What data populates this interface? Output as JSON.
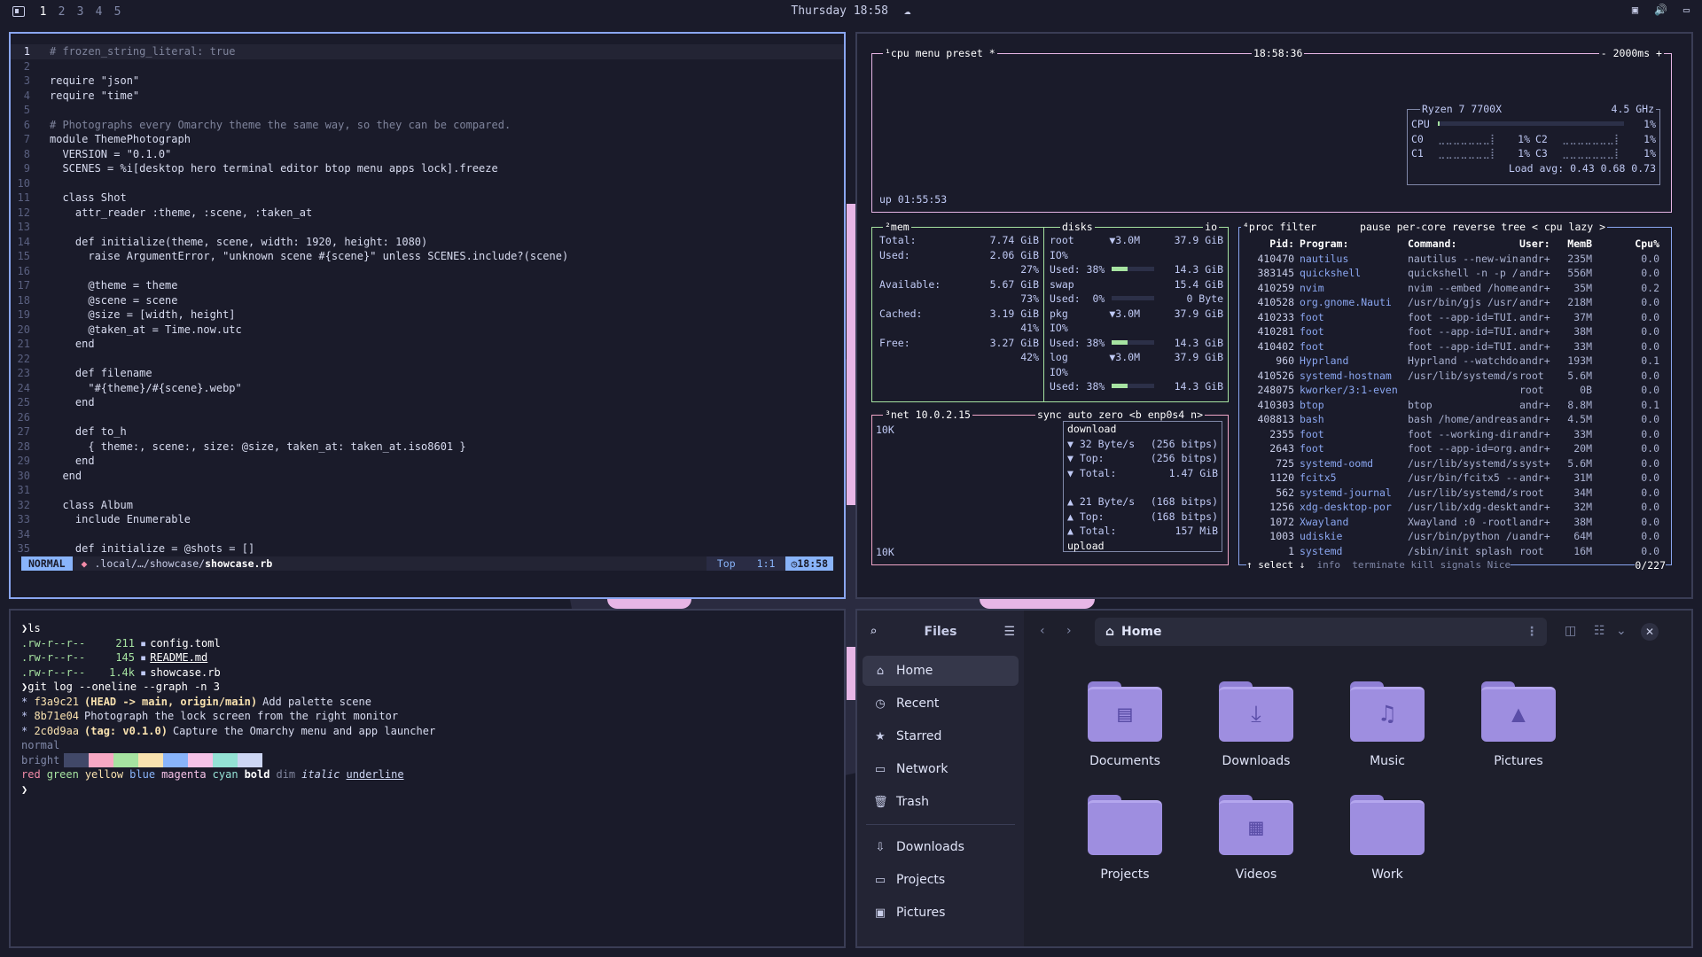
{
  "topbar": {
    "workspaces": [
      "1",
      "2",
      "3",
      "4",
      "5"
    ],
    "active_workspace": "1",
    "clock": "Thursday 18:58",
    "icons": [
      "screenshot-icon",
      "volume-icon",
      "monitor-icon"
    ]
  },
  "editor": {
    "lines": [
      {
        "n": "1",
        "t": "# frozen_string_literal: true"
      },
      {
        "n": "2",
        "t": ""
      },
      {
        "n": "3",
        "t": "require \"json\""
      },
      {
        "n": "4",
        "t": "require \"time\""
      },
      {
        "n": "5",
        "t": ""
      },
      {
        "n": "6",
        "t": "# Photographs every Omarchy theme the same way, so they can be compared."
      },
      {
        "n": "7",
        "t": "module ThemePhotograph"
      },
      {
        "n": "8",
        "t": "  VERSION = \"0.1.0\""
      },
      {
        "n": "9",
        "t": "  SCENES = %i[desktop hero terminal editor btop menu apps lock].freeze"
      },
      {
        "n": "10",
        "t": ""
      },
      {
        "n": "11",
        "t": "  class Shot"
      },
      {
        "n": "12",
        "t": "    attr_reader :theme, :scene, :taken_at"
      },
      {
        "n": "13",
        "t": ""
      },
      {
        "n": "14",
        "t": "    def initialize(theme, scene, width: 1920, height: 1080)"
      },
      {
        "n": "15",
        "t": "      raise ArgumentError, \"unknown scene #{scene}\" unless SCENES.include?(scene)"
      },
      {
        "n": "16",
        "t": ""
      },
      {
        "n": "17",
        "t": "      @theme = theme"
      },
      {
        "n": "18",
        "t": "      @scene = scene"
      },
      {
        "n": "19",
        "t": "      @size = [width, height]"
      },
      {
        "n": "20",
        "t": "      @taken_at = Time.now.utc"
      },
      {
        "n": "21",
        "t": "    end"
      },
      {
        "n": "22",
        "t": ""
      },
      {
        "n": "23",
        "t": "    def filename"
      },
      {
        "n": "24",
        "t": "      \"#{theme}/#{scene}.webp\""
      },
      {
        "n": "25",
        "t": "    end"
      },
      {
        "n": "26",
        "t": ""
      },
      {
        "n": "27",
        "t": "    def to_h"
      },
      {
        "n": "28",
        "t": "      { theme:, scene:, size: @size, taken_at: taken_at.iso8601 }"
      },
      {
        "n": "29",
        "t": "    end"
      },
      {
        "n": "30",
        "t": "  end"
      },
      {
        "n": "31",
        "t": ""
      },
      {
        "n": "32",
        "t": "  class Album"
      },
      {
        "n": "33",
        "t": "    include Enumerable"
      },
      {
        "n": "34",
        "t": ""
      },
      {
        "n": "35",
        "t": "    def initialize = @shots = []"
      }
    ],
    "status": {
      "mode": "NORMAL",
      "path_prefix": ".local/…/showcase/",
      "file": "showcase.rb",
      "scroll": "Top",
      "position": "1:1",
      "time": "18:58"
    }
  },
  "btop": {
    "cpu": {
      "title": "¹cpu",
      "menu": "menu",
      "preset": "preset *",
      "clock": "18:58:36",
      "interval": "- 2000ms +",
      "model": "Ryzen 7 7700X",
      "freq": "4.5 GHz",
      "rows": [
        {
          "label": "CPU",
          "val": "1%"
        },
        {
          "label": "C0",
          "val": "1%",
          "label2": "C2",
          "val2": "1%"
        },
        {
          "label": "C1",
          "val": "1%",
          "label2": "C3",
          "val2": "1%"
        }
      ],
      "load": "Load avg: 0.43 0.68 0.73",
      "uptime": "up 01:55:53"
    },
    "mem": {
      "title": "²mem",
      "disks_title": "disks",
      "io_title": "io",
      "rows": [
        {
          "k": "Total:",
          "v": "7.74 GiB"
        },
        {
          "k": "Used:",
          "v": "2.06 GiB"
        },
        {
          "k": "",
          "v": "27%"
        },
        {
          "k": "Available:",
          "v": "5.67 GiB"
        },
        {
          "k": "",
          "v": "73%"
        },
        {
          "k": "Cached:",
          "v": "3.19 GiB"
        },
        {
          "k": "",
          "v": "41%"
        },
        {
          "k": "Free:",
          "v": "3.27 GiB"
        },
        {
          "k": "",
          "v": "42%"
        }
      ],
      "disks": [
        {
          "a": "root",
          "b": "▼3.0M",
          "c": "37.9 GiB"
        },
        {
          "a": "IO%",
          "b": "",
          "c": ""
        },
        {
          "a": "Used: 38%",
          "b": "",
          "c": "14.3 GiB",
          "fill": 0.38
        },
        {
          "a": "swap",
          "b": "",
          "c": "15.4 GiB"
        },
        {
          "a": "Used:  0%",
          "b": "",
          "c": "0 Byte",
          "fill": 0.0
        },
        {
          "a": "pkg",
          "b": "▼3.0M",
          "c": "37.9 GiB"
        },
        {
          "a": "IO%",
          "b": "",
          "c": ""
        },
        {
          "a": "Used: 38%",
          "b": "",
          "c": "14.3 GiB",
          "fill": 0.38
        },
        {
          "a": "log",
          "b": "▼3.0M",
          "c": "37.9 GiB"
        },
        {
          "a": "IO%",
          "b": "",
          "c": ""
        },
        {
          "a": "Used: 38%",
          "b": "",
          "c": "14.3 GiB",
          "fill": 0.38
        }
      ]
    },
    "net": {
      "title": "³net",
      "ip": "10.0.2.15",
      "controls": [
        "sync",
        "auto",
        "zero",
        "<b enp0s4 n>"
      ],
      "scale_top": "10K",
      "scale_bottom": "10K",
      "download": [
        {
          "k": "download",
          "v": ""
        },
        {
          "k": "▼ 32 Byte/s",
          "v": "(256 bitps)"
        },
        {
          "k": "▼ Top:",
          "v": "(256 bitps)"
        },
        {
          "k": "▼ Total:",
          "v": "1.47 GiB"
        }
      ],
      "upload": [
        {
          "k": "▲ 21 Byte/s",
          "v": "(168 bitps)"
        },
        {
          "k": "▲ Top:",
          "v": "(168 bitps)"
        },
        {
          "k": "▲ Total:",
          "v": "157 MiB"
        },
        {
          "k": "upload",
          "v": ""
        }
      ]
    },
    "proc": {
      "title": "⁴proc",
      "controls": [
        "filter",
        "pause",
        "per-core",
        "reverse",
        "tree",
        "< cpu lazy >"
      ],
      "headers": [
        "Pid:",
        "Program:",
        "Command:",
        "User:",
        "MemB",
        "",
        "Cpu%"
      ],
      "rows": [
        [
          "410470",
          "nautilus",
          "nautilus --new-win",
          "andr+",
          "235M",
          "",
          "0.0"
        ],
        [
          "383145",
          "quickshell",
          "quickshell -n -p /",
          "andr+",
          "556M",
          "",
          "0.0"
        ],
        [
          "410259",
          "nvim",
          "nvim --embed /home",
          "andr+",
          "35M",
          "",
          "0.2"
        ],
        [
          "410528",
          "org.gnome.Nauti",
          "/usr/bin/gjs /usr/",
          "andr+",
          "218M",
          "",
          "0.0"
        ],
        [
          "410233",
          "foot",
          "foot --app-id=TUI.",
          "andr+",
          "37M",
          "",
          "0.0"
        ],
        [
          "410281",
          "foot",
          "foot --app-id=TUI.",
          "andr+",
          "38M",
          "",
          "0.0"
        ],
        [
          "410402",
          "foot",
          "foot --app-id=TUI.",
          "andr+",
          "33M",
          "",
          "0.0"
        ],
        [
          "960",
          "Hyprland",
          "Hyprland --watchdo",
          "andr+",
          "193M",
          "",
          "0.1"
        ],
        [
          "410526",
          "systemd-hostnam",
          "/usr/lib/systemd/s",
          "root",
          "5.6M",
          "",
          "0.0"
        ],
        [
          "248075",
          "kworker/3:1-even",
          "",
          "root",
          "0B",
          "",
          "0.0"
        ],
        [
          "410303",
          "btop",
          "btop",
          "andr+",
          "8.8M",
          "",
          "0.1"
        ],
        [
          "408813",
          "bash",
          "bash /home/andreas",
          "andr+",
          "4.5M",
          "",
          "0.0"
        ],
        [
          "2355",
          "foot",
          "foot --working-dir",
          "andr+",
          "33M",
          "",
          "0.0"
        ],
        [
          "2643",
          "foot",
          "foot --app-id=org.",
          "andr+",
          "20M",
          "",
          "0.0"
        ],
        [
          "725",
          "systemd-oomd",
          "/usr/lib/systemd/s",
          "syst+",
          "5.6M",
          "",
          "0.0"
        ],
        [
          "1120",
          "fcitx5",
          "/usr/bin/fcitx5 --",
          "andr+",
          "31M",
          "",
          "0.0"
        ],
        [
          "562",
          "systemd-journal",
          "/usr/lib/systemd/s",
          "root",
          "34M",
          "",
          "0.0"
        ],
        [
          "1256",
          "xdg-desktop-por",
          "/usr/lib/xdg-deskt",
          "andr+",
          "32M",
          "",
          "0.0"
        ],
        [
          "1072",
          "Xwayland",
          "Xwayland :0 -rootl",
          "andr+",
          "38M",
          "",
          "0.0"
        ],
        [
          "1003",
          "udiskie",
          "/usr/bin/python /u",
          "andr+",
          "64M",
          "",
          "0.0"
        ],
        [
          "1",
          "systemd",
          "/sbin/init splash",
          "root",
          "16M",
          "",
          "0.0"
        ]
      ],
      "footer": [
        "↑ select ↓",
        "info",
        "terminate",
        "kill",
        "signals",
        "Nice"
      ],
      "count": "0/227"
    }
  },
  "terminal": {
    "prompt_symbol": "❯",
    "cmd1": "ls",
    "ls": [
      {
        "perm": ".rw-r--r--",
        "size": "211",
        "icon": "",
        "name": "config.toml"
      },
      {
        "perm": ".rw-r--r--",
        "size": "145",
        "icon": "",
        "name": "README.md"
      },
      {
        "perm": ".rw-r--r--",
        "size": "1.4k",
        "icon": "",
        "name": "showcase.rb"
      }
    ],
    "cmd2": "git log --oneline --graph -n 3",
    "log": [
      {
        "hash": "f3a9c21",
        "ref": "(HEAD -> main, origin/main)",
        "msg": "Add palette scene"
      },
      {
        "hash": "8b71e04",
        "ref": "",
        "msg": "Photograph the lock screen from the right monitor"
      },
      {
        "hash": "2c0d9aa",
        "ref": "(tag: v0.1.0)",
        "msg": "Capture the Omarchy menu and app launcher"
      }
    ],
    "normal_label": "normal",
    "bright_label": "bright",
    "bright_colors": [
      "#414868",
      "#f7a8c4",
      "#a6e3a1",
      "#f9e2af",
      "#89b4fa",
      "#f5c2e7",
      "#94e2d5",
      "#cdd6f4"
    ],
    "words": [
      {
        "t": "red",
        "c": "#f38ba8"
      },
      {
        "t": "green",
        "c": "#a6e3a1"
      },
      {
        "t": "yellow",
        "c": "#f9e2af"
      },
      {
        "t": "blue",
        "c": "#89b4fa"
      },
      {
        "t": "magenta",
        "c": "#f5c2e7"
      },
      {
        "t": "cyan",
        "c": "#94e2d5"
      },
      {
        "t": "bold",
        "c": "#ffffff"
      },
      {
        "t": "dim",
        "c": "#7f849c"
      },
      {
        "t": "italic",
        "c": "#cdd6f4"
      },
      {
        "t": "underline",
        "c": "#cdd6f4"
      }
    ]
  },
  "files": {
    "title": "Files",
    "location": "Home",
    "sidebar": [
      {
        "label": "Home",
        "icon": "⌂",
        "name": "home"
      },
      {
        "label": "Recent",
        "icon": "◷",
        "name": "recent"
      },
      {
        "label": "Starred",
        "icon": "★",
        "name": "starred"
      },
      {
        "label": "Network",
        "icon": "▭",
        "name": "network"
      },
      {
        "label": "Trash",
        "icon": "🗑",
        "name": "trash"
      }
    ],
    "bookmarks": [
      {
        "label": "Downloads",
        "icon": "⇩",
        "name": "downloads"
      },
      {
        "label": "Projects",
        "icon": "▭",
        "name": "projects"
      },
      {
        "label": "Pictures",
        "icon": "▣",
        "name": "pictures"
      }
    ],
    "folders": [
      {
        "label": "Documents",
        "glyph": "▤",
        "name": "documents"
      },
      {
        "label": "Downloads",
        "glyph": "⤓",
        "name": "downloads"
      },
      {
        "label": "Music",
        "glyph": "♫",
        "name": "music"
      },
      {
        "label": "Pictures",
        "glyph": "▲",
        "name": "pictures"
      },
      {
        "label": "Projects",
        "glyph": "",
        "name": "projects"
      },
      {
        "label": "Videos",
        "glyph": "▦",
        "name": "videos"
      },
      {
        "label": "Work",
        "glyph": "",
        "name": "work"
      }
    ]
  },
  "colors": {
    "accent": "#8aa6f0",
    "pink": "#e7b6e6",
    "green": "#a6e3a1",
    "folder": "#9e8ee0"
  }
}
